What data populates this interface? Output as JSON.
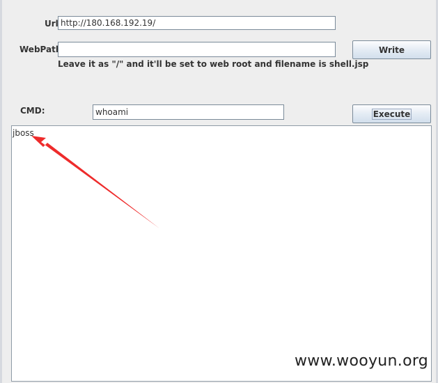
{
  "form": {
    "url_label": "Url:",
    "url_value": "http://180.168.192.19/",
    "webpath_label": "WebPath:",
    "webpath_value": "",
    "hint_text": "Leave it as \"/\" and it'll be set to web root and filename is shell.jsp",
    "write_button_label": "Write",
    "cmd_label": "CMD:",
    "cmd_value": "whoami",
    "execute_button_label": "Execute"
  },
  "output": {
    "text": "jboss"
  },
  "annotation": {
    "arrow_color": "#ee2b2b"
  },
  "watermark": {
    "text": "www.wooyun.org"
  }
}
